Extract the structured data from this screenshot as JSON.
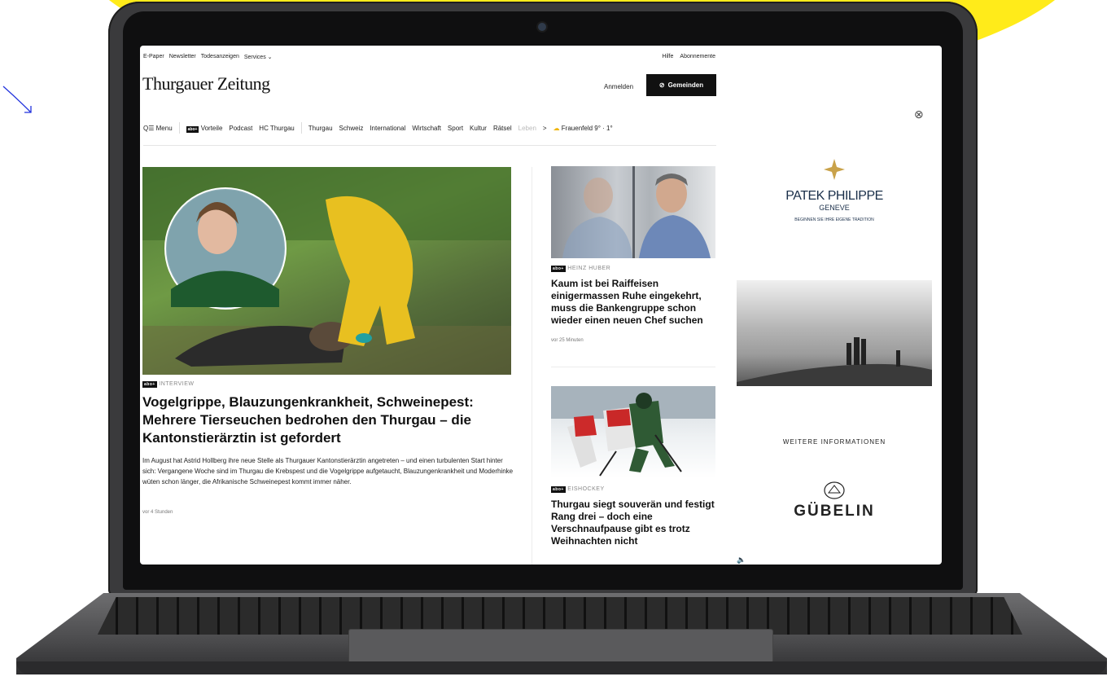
{
  "site": {
    "top_links": [
      "E-Paper",
      "Newsletter",
      "Todesanzeigen",
      "Services"
    ],
    "top_right_links": [
      "Hilfe",
      "Abonnemente"
    ],
    "logo": "Thurgauer Zeitung",
    "login_label": "Anmelden",
    "join_label": "Gemeinden"
  },
  "nav": {
    "menu_label": "Menu",
    "abo_badge": "abo+",
    "items": [
      "Vorteile",
      "Podcast",
      "HC Thurgau",
      "Thurgau",
      "Schweiz",
      "International",
      "Wirtschaft",
      "Sport",
      "Kultur",
      "Rätsel",
      "Leben"
    ],
    "weather_location": "Frauenfeld",
    "weather_temp": "9° · 1°"
  },
  "hero": {
    "badge": "abo+",
    "tag": "INTERVIEW",
    "title": "Vogelgrippe, Blauzungenkrankheit, Schweinepest: Mehrere Tierseuchen bedrohen den Thurgau – die Kantonstierärztin ist gefordert",
    "lead": "Im August hat Astrid Hollberg ihre neue Stelle als Thurgauer Kantonstierärztin angetreten – und einen turbulenten Start hinter sich: Vergangene Woche sind im Thurgau die Krebspest und die Vogelgrippe aufgetaucht, Blauzungenkrankheit und Moderhinke wüten schon länger, die Afrikanische Schweinepest kommt immer näher.",
    "time": "vor 4 Stunden"
  },
  "side_articles": [
    {
      "badge": "abo+",
      "tag": "HEINZ HUBER",
      "title": "Kaum ist bei Raiffeisen einigermassen Ruhe eingekehrt, muss die Bankengruppe schon wieder einen neuen Chef suchen",
      "time": "vor 25 Minuten"
    },
    {
      "badge": "abo+",
      "tag": "EISHOCKEY",
      "title": "Thurgau siegt souverän und festigt Rang drei – doch eine Verschnaufpause gibt es trotz Weihnachten nicht"
    }
  ],
  "ad": {
    "brand": "PATEK PHILIPPE",
    "brand_sub": "GENEVE",
    "claim": "BEGINNEN SIE IHRE EIGENE TRADITION",
    "more_info": "WEITERE INFORMATIONEN",
    "retailer": "GÜBELIN"
  },
  "colors": {
    "background_blob": "#ffeb1a",
    "brand_dark": "#111111",
    "ad_navy": "#1a2f4a"
  }
}
